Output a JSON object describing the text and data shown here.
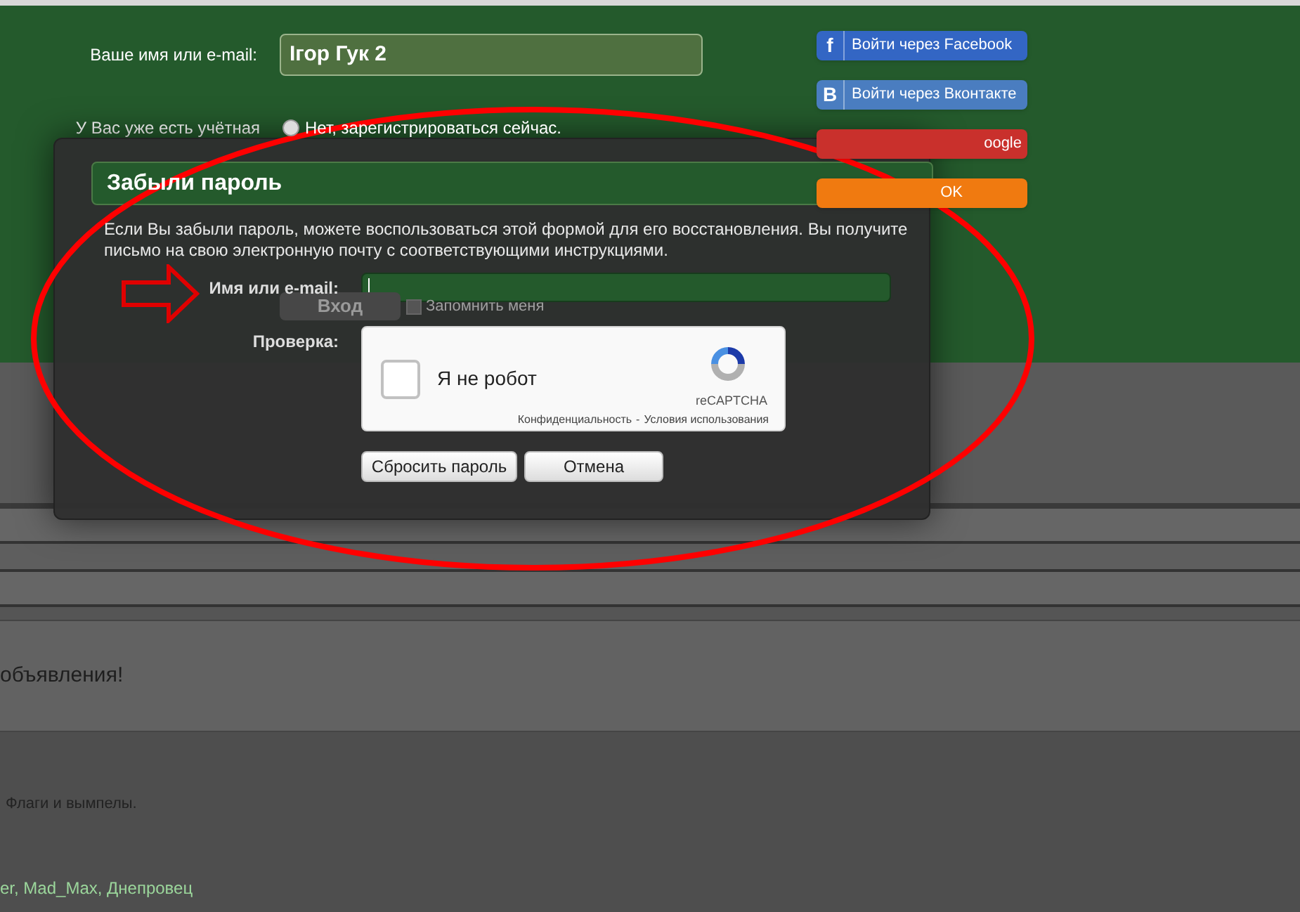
{
  "login_form": {
    "name_label": "Ваше имя или e-mail:",
    "name_value": "Ігор Гук 2",
    "account_label": "У Вас уже есть учётная",
    "account_options": [
      {
        "label": "Нет, зарегистрироваться сейчас.",
        "selected": false
      }
    ],
    "login_button": "Вход",
    "remember": {
      "label": "Запомнить меня",
      "checked": false
    }
  },
  "social_buttons": [
    {
      "kind": "facebook",
      "icon_text": "f",
      "label": "Войти через Facebook"
    },
    {
      "kind": "vkontakte",
      "icon_text": "B",
      "label": "Войти через Вконтакте"
    },
    {
      "kind": "google",
      "label": "oogle"
    },
    {
      "kind": "ok",
      "label": "OK"
    }
  ],
  "page": {
    "notice": "объявления!",
    "forum_line": "Флаги и вымпелы.",
    "users_line": "er, Mad_Max, Днепровец"
  },
  "dialog": {
    "title": "Забыли пароль",
    "description": "Если Вы забыли пароль, можете воспользоваться этой формой для его восстановления. Вы получите письмо на свою электронную почту с соответствующими инструкциями.",
    "field_label": "Имя или e-mail:",
    "check_label": "Проверка:",
    "captcha": {
      "label": "Я не робот",
      "checked": false,
      "brand": "reCAPTCHA",
      "links": [
        "Конфиденциальность",
        "Условия использования"
      ],
      "links_separator": "-"
    },
    "buttons": [
      "Сбросить пароль",
      "Отмена"
    ]
  }
}
